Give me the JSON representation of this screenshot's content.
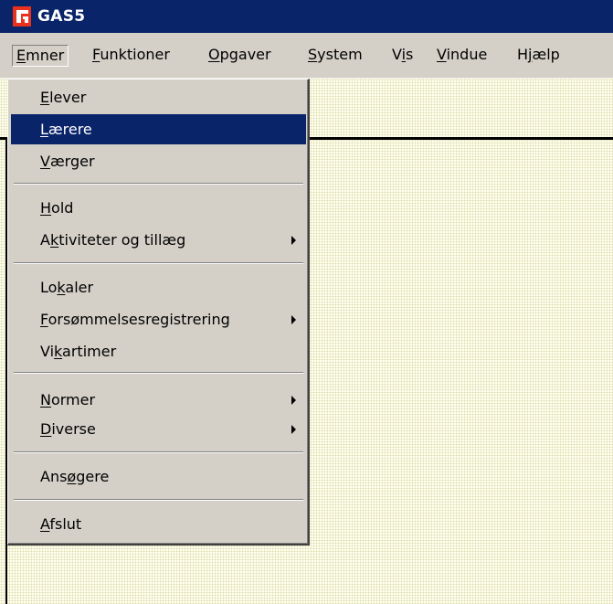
{
  "window": {
    "title": "GAS5",
    "logo_icon": "gas-logo-icon"
  },
  "menubar": [
    {
      "pre": "",
      "key": "E",
      "post": "mner"
    },
    {
      "pre": "",
      "key": "F",
      "post": "unktioner"
    },
    {
      "pre": "",
      "key": "O",
      "post": "pgaver"
    },
    {
      "pre": "",
      "key": "S",
      "post": "ystem"
    },
    {
      "pre": "V",
      "key": "i",
      "post": "s"
    },
    {
      "pre": "",
      "key": "V",
      "post": "indue"
    },
    {
      "pre": "H",
      "key": "j",
      "post": "ælp"
    }
  ],
  "menu": {
    "open_menu": "Emner",
    "selected_item": "Lærere",
    "colors": {
      "highlight": "#0a246a",
      "menu_bg": "#d4d0c8",
      "client_bg": "#fffff0"
    },
    "items": [
      {
        "pre": "",
        "key": "E",
        "post": "lever"
      },
      {
        "pre": "",
        "key": "L",
        "post": "ærere"
      },
      {
        "pre": "",
        "key": "V",
        "post": "ærger"
      },
      {
        "pre": "",
        "key": "H",
        "post": "old"
      },
      {
        "pre": "A",
        "key": "k",
        "post": "tiviteter og tillæg"
      },
      {
        "pre": "Lo",
        "key": "k",
        "post": "aler"
      },
      {
        "pre": "",
        "key": "F",
        "post": "orsømmelsesregistrering"
      },
      {
        "pre": "Vi",
        "key": "k",
        "post": "artimer"
      },
      {
        "pre": "",
        "key": "N",
        "post": "ormer"
      },
      {
        "pre": "",
        "key": "D",
        "post": "iverse"
      },
      {
        "pre": "Ans",
        "key": "ø",
        "post": "gere"
      },
      {
        "pre": "",
        "key": "A",
        "post": "fslut"
      }
    ]
  }
}
